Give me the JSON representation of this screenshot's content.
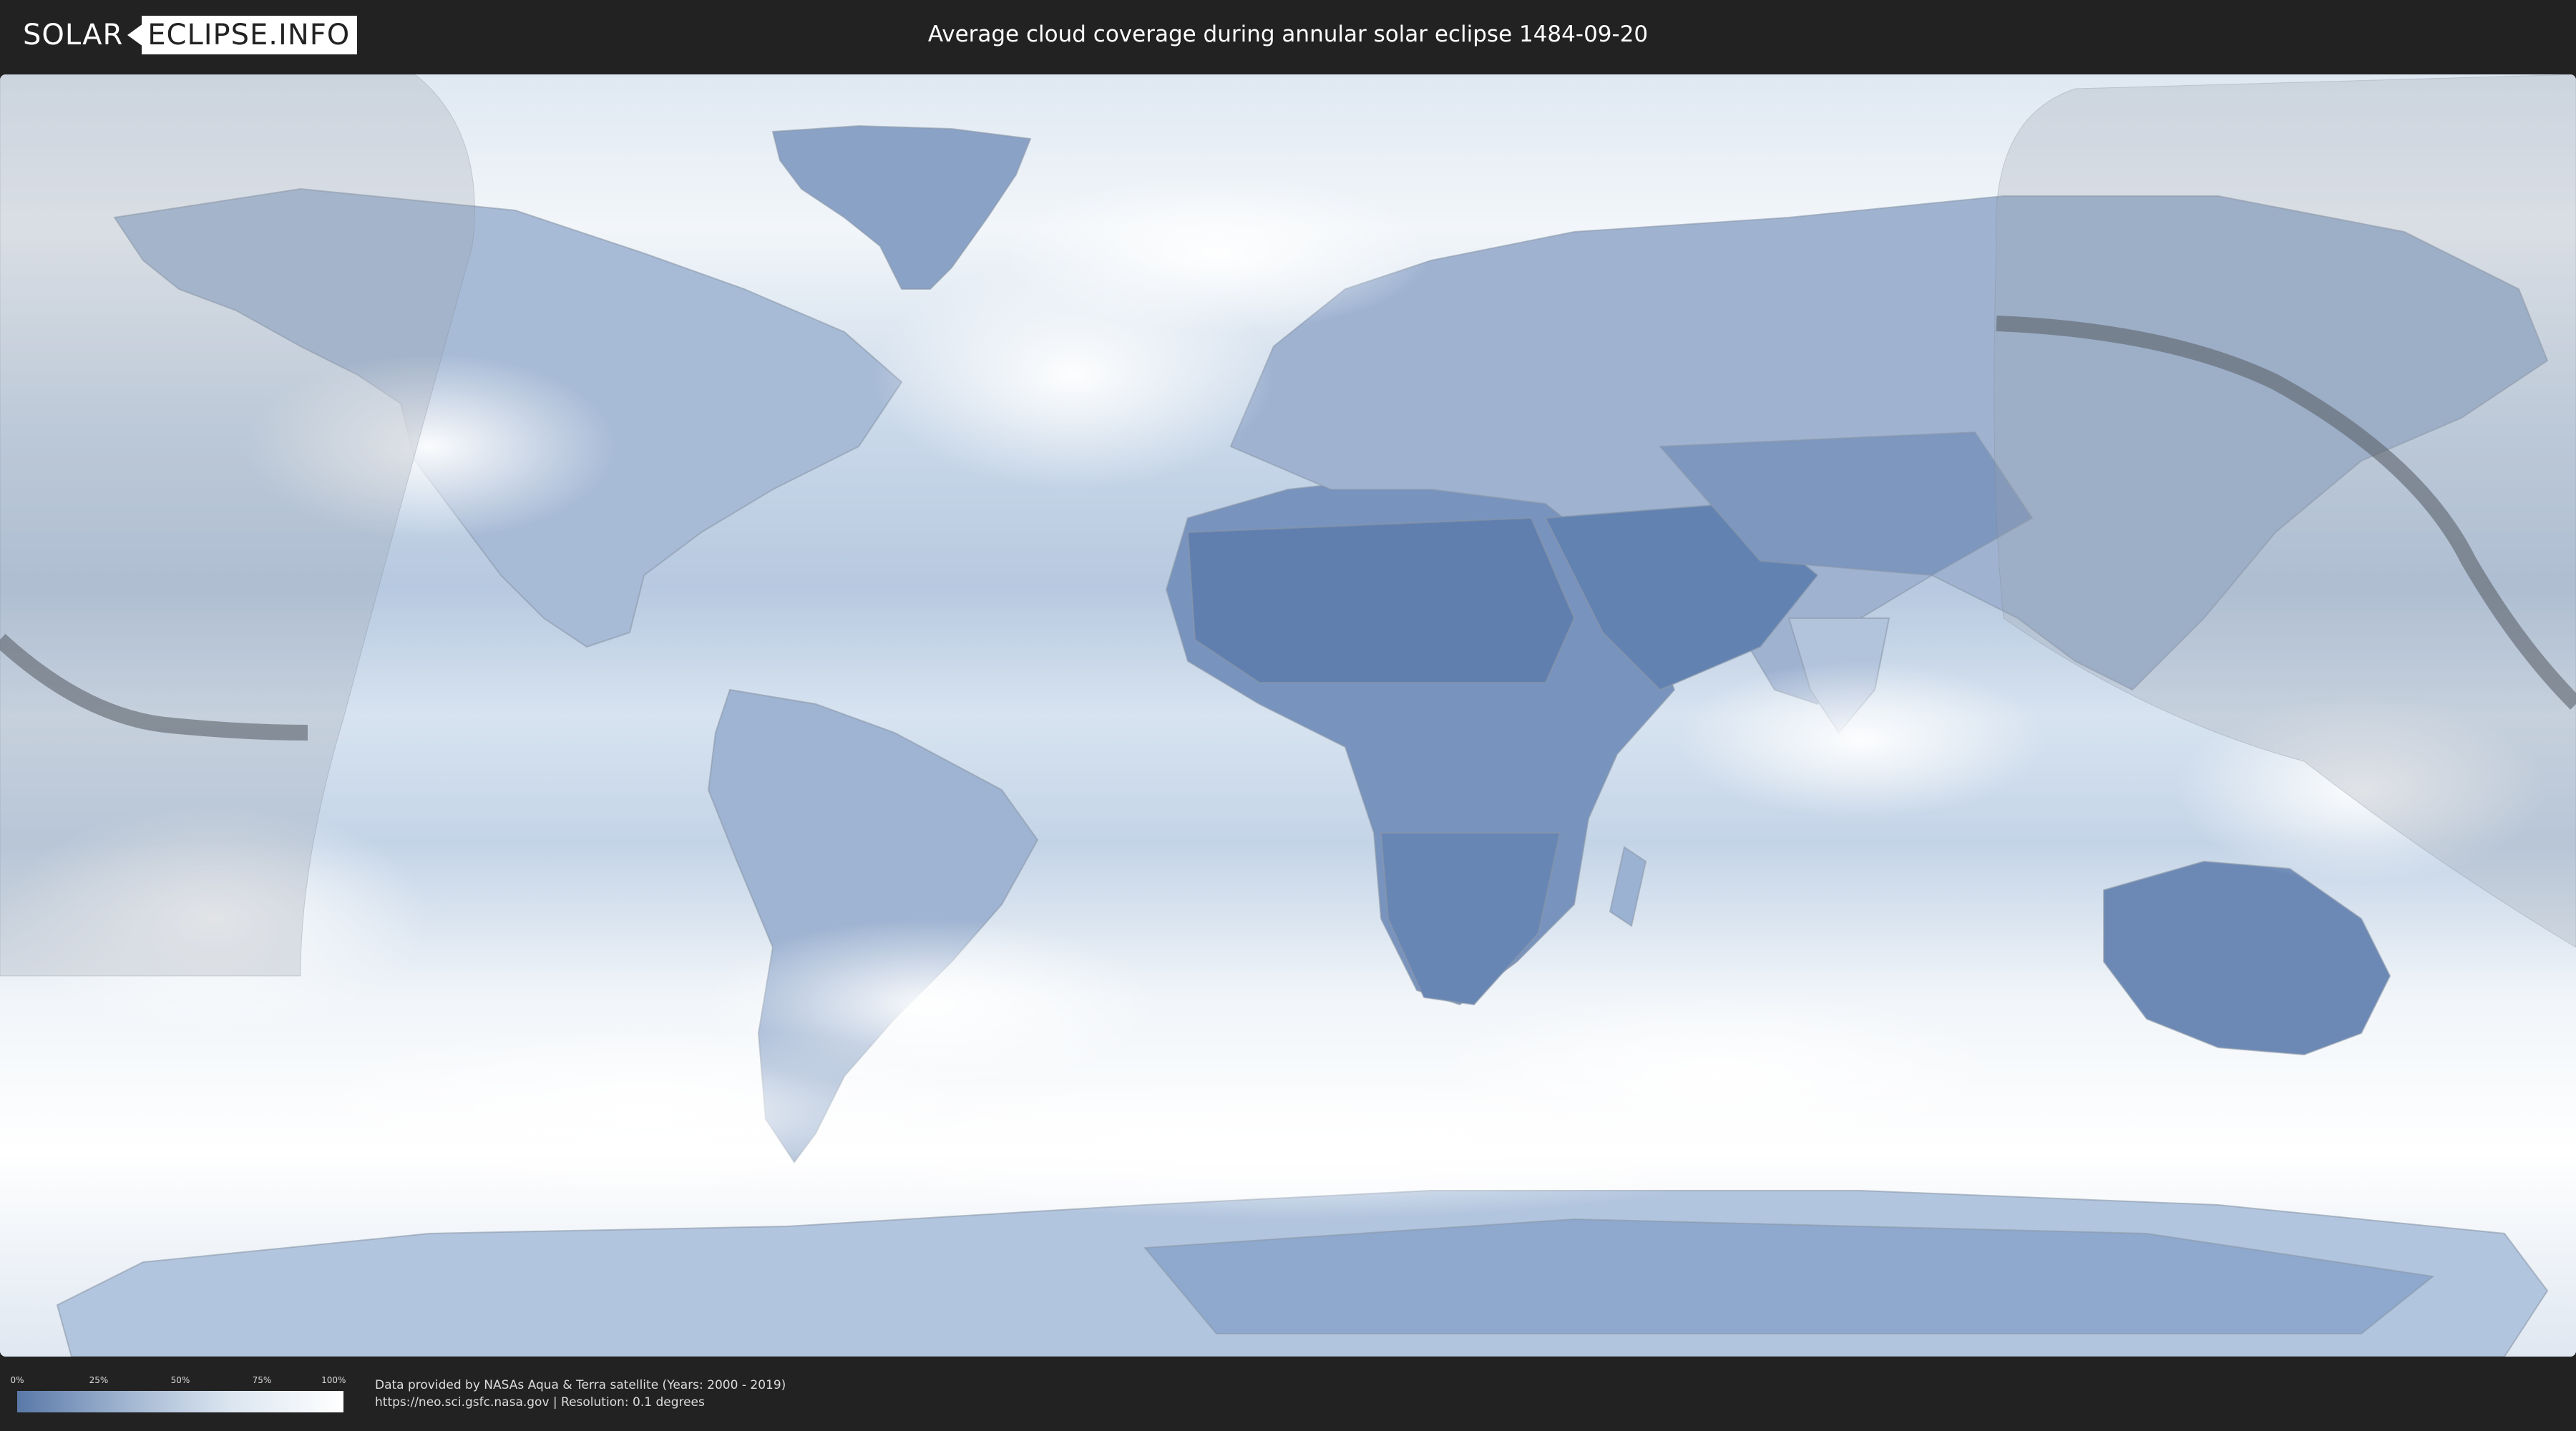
{
  "header": {
    "logo_left": "SOLAR",
    "logo_right": "ECLIPSE.INFO",
    "title": "Average cloud coverage during annular solar eclipse 1484-09-20"
  },
  "map": {
    "colors": {
      "ocean_light": "#e9eff6",
      "cloud_white": "#f7f9fc",
      "land_clear": "#5f7eaf",
      "land_mid": "#8fa8c9",
      "eclipse_overlay": "#9aa3ad",
      "path_line": "#5b636b"
    }
  },
  "legend": {
    "ticks": [
      "0%",
      "25%",
      "50%",
      "75%",
      "100%"
    ],
    "colors": [
      "#5a79a8",
      "#ffffff"
    ]
  },
  "footer": {
    "credit_line1": "Data provided by NASAs Aqua & Terra satellite (Years: 2000 - 2019)",
    "credit_line2": "https://neo.sci.gsfc.nasa.gov | Resolution: 0.1 degrees"
  }
}
